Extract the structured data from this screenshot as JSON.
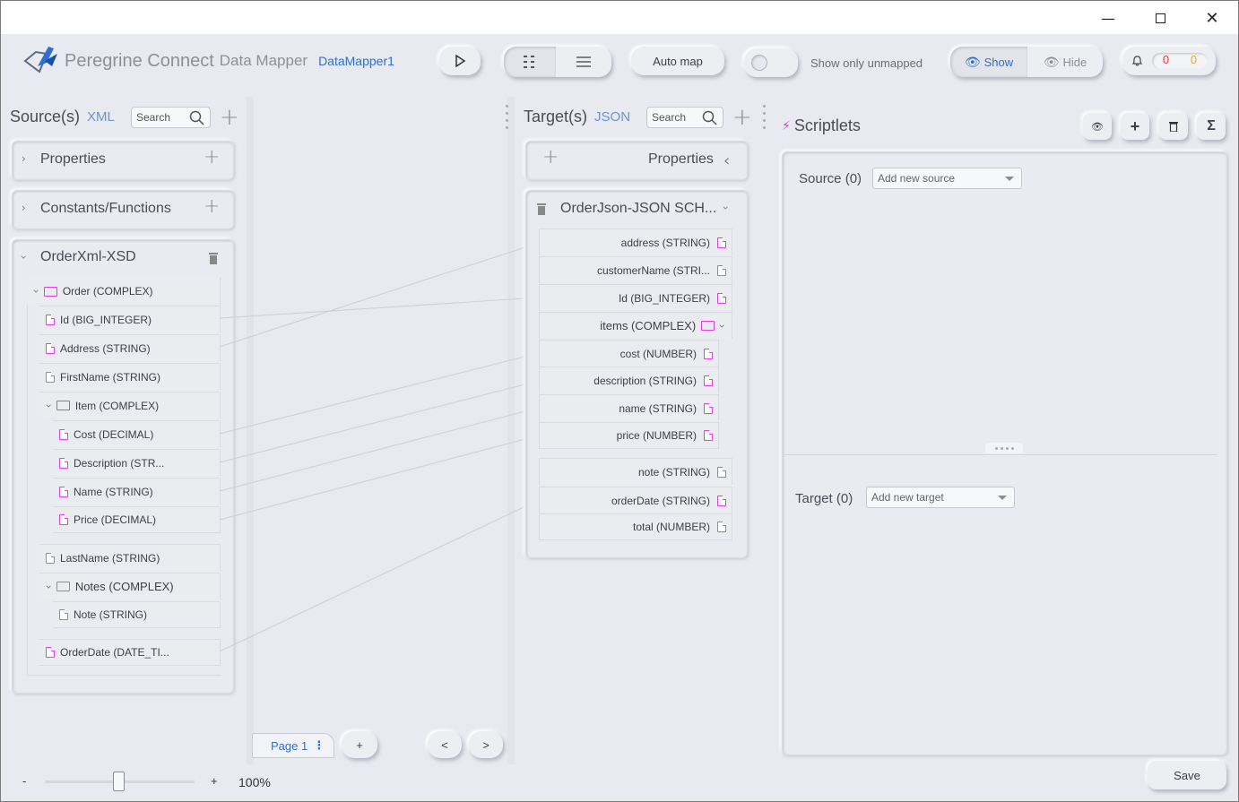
{
  "header": {
    "brand": "Peregrine Connect",
    "product": "Data Mapper",
    "mapper_name": "DataMapper1",
    "auto_map": "Auto map",
    "show_only_unmapped": "Show only unmapped",
    "show": "Show",
    "hide": "Hide",
    "errors": "0",
    "warnings": "0"
  },
  "source": {
    "title": "Source(s)",
    "format": "XML",
    "search_placeholder": "Search",
    "properties": "Properties",
    "constants": "Constants/Functions",
    "schema": "OrderXml-XSD",
    "rows": [
      "Order (COMPLEX)",
      "Id (BIG_INTEGER)",
      "Address (STRING)",
      "FirstName (STRING)",
      "Item (COMPLEX)",
      "Cost (DECIMAL)",
      "Description (STR...",
      "Name (STRING)",
      "Price (DECIMAL)",
      "LastName (STRING)",
      "Notes (COMPLEX)",
      "Note (STRING)",
      "OrderDate (DATE_TI..."
    ]
  },
  "target": {
    "title": "Target(s)",
    "format": "JSON",
    "search_placeholder": "Search",
    "properties": "Properties",
    "schema": "OrderJson-JSON SCH...",
    "rows": [
      "address (STRING)",
      "customerName (STRI...",
      "Id (BIG_INTEGER)",
      "items (COMPLEX)",
      "cost (NUMBER)",
      "description (STRING)",
      "name (STRING)",
      "price (NUMBER)",
      "note (STRING)",
      "orderDate (STRING)",
      "total (NUMBER)"
    ]
  },
  "scriptlets": {
    "title": "Scriptlets",
    "source_label": "Source (0)",
    "source_placeholder": "Add new source",
    "target_label": "Target (0)",
    "target_placeholder": "Add new target",
    "sigma": "Σ"
  },
  "footer": {
    "page": "Page 1",
    "add": "+",
    "prev": "<",
    "next": ">",
    "zoom_minus": "-",
    "zoom_plus": "+",
    "zoom": "100%",
    "save": "Save"
  },
  "colors": {
    "accent": "#2f6fd0",
    "mapped": "#e13ee6",
    "error": "#e53935",
    "warning": "#f5a623"
  }
}
